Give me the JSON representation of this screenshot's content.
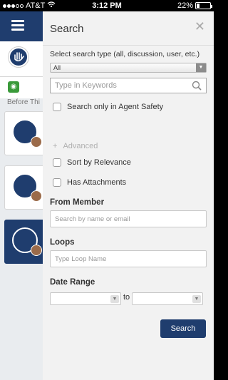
{
  "status_bar": {
    "carrier": "AT&T",
    "time": "3:12 PM",
    "battery": "22%",
    "battery_level": 0.22
  },
  "background": {
    "before_text": "Before Thi"
  },
  "search_panel": {
    "title": "Search",
    "close_icon": "close-icon",
    "type_label": "Select search type (all, discussion, user, etc.)",
    "type_selected": "All",
    "keywords_placeholder": "Type in Keywords",
    "only_agent_safety": "Search only in Agent Safety",
    "advanced_toggle": "+",
    "advanced_label": "Advanced",
    "sort_by_relevance": "Sort by Relevance",
    "has_attachments": "Has Attachments",
    "from_member_label": "From Member",
    "from_member_placeholder": "Search by name or email",
    "loops_label": "Loops",
    "loops_placeholder": "Type Loop Name",
    "date_range_label": "Date Range",
    "to_label": "to",
    "search_button": "Search"
  },
  "colors": {
    "navy": "#1f3d6e",
    "panel": "#f2f2f2"
  }
}
